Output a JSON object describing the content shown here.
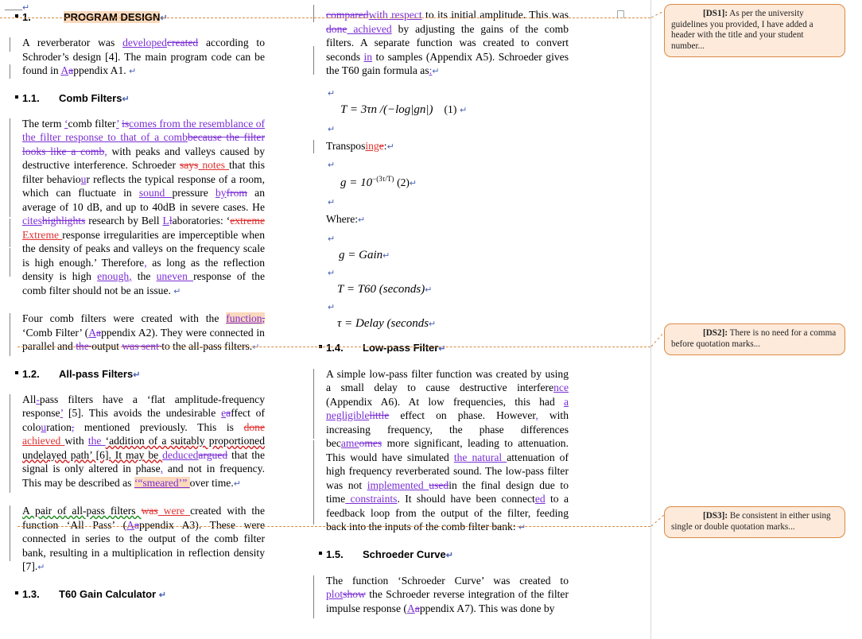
{
  "document": {
    "view": "word-track-changes-two-column",
    "colors": {
      "insert": "#7b2fd4",
      "insert_alt": "#e03030",
      "comment_fill": "#fdeadb",
      "comment_border": "#d98b45",
      "highlight": "#fbd9bd",
      "changebar": "#808080"
    }
  },
  "column_one": {
    "heading_1": {
      "number": "1.",
      "title": "PROGRAM DESIGN"
    },
    "para_1": {
      "t1": "A reverberator was ",
      "ins1": "developed",
      "del1": "created",
      "t2": " according to Schroder’s design [4]. The main program code can be found in ",
      "ins2": "A",
      "del2": "a",
      "t3": "ppendix A1. "
    },
    "heading_1_1": {
      "number": "1.1.",
      "title": "Comb Filters"
    },
    "para_2": {
      "t1": "The term ",
      "ins_q1": "‘",
      "t2": "comb filter",
      "ins_q2": "’",
      "t3": " ",
      "del1": "is",
      "ins1": "comes from the resemblance of the filter response to that of a comb",
      "del2": "because the filter looks like a comb",
      "ins_comma": ",",
      "t4": " with peaks and valleys caused by destructive interference. Schroeder ",
      "del3": "says",
      "ins2": " notes ",
      "t5": "that this filter behavio",
      "ins3": "u",
      "t6": "r reflects the typical response of a room, which can fluctuate in ",
      "ins4": "sound ",
      "t7": "pressure ",
      "ins5": "by",
      "del4": "from",
      "t8": " an average of 10 dB, and up to 40dB in severe cases. He ",
      "ins6": "cites",
      "del5": "highlights",
      "t9": " research by Bell ",
      "ins7": "L",
      "del6": "l",
      "t10": "aboratories: ‘",
      "del7": "extreme",
      "ins8": " Extreme ",
      "t11": "response irregularities are imperceptible when the density of peaks and valleys on the frequency scale is high enough.’ Therefore",
      "ins_c2": ",",
      "t12": " as long as the reflection density is high ",
      "ins9": "enough",
      "ins_c3": ",",
      "t13": " the ",
      "ins10": "uneven ",
      "t14": "response of the comb filter should not be an issue. "
    },
    "para_3": {
      "t1": "Four comb filters were created with the ",
      "hl_ins": "function",
      "hl_del": ",",
      "t2": " ‘Comb Filter’ (",
      "ins1": "A",
      "del1": "a",
      "t3": "ppendix A2). They were connected in parallel and ",
      "del2": "the ",
      "t4": "output ",
      "del3": "was sent ",
      "t5": "to the all-pass filters."
    },
    "heading_1_2": {
      "number": "1.2.",
      "title": "All-pass Filters"
    },
    "para_4": {
      "t1": "All",
      "ins_hyph": "-",
      "t2": "pass filters have a ‘flat amplitude-frequency response",
      "ins_q": "’",
      "t3": " [5]. This avoids the undesirable ",
      "ins1": "e",
      "del1": "a",
      "t4": "ffect of colo",
      "ins2": "u",
      "t5": "ration",
      "del2": ",",
      "t6": " mentioned previously. This is ",
      "del3": "done",
      "ins3": " achieved ",
      "t7": "with ",
      "ins4": "the ",
      "t8": "‘addition of a suitably proportioned undelayed path’ [6]. It may be ",
      "ins5": "deduced",
      "del4": "argued",
      "t9": " that the signal is only altered in phase",
      "ins_c": ",",
      "t10": " and not in frequency. This may be described as ",
      "hl": "‘“smeared’” ",
      "t11": "over time."
    },
    "para_5": {
      "t1": "A pair of all-pass filters ",
      "del1": "was",
      "ins1": " were ",
      "t2": "created with the function ‘All Pass’ (",
      "ins2": "A",
      "del2": "a",
      "t3": "ppendix A3). These were connected in series to the output of the comb filter bank, resulting in a multiplication in reflection density [7]."
    },
    "heading_1_3": {
      "number": "1.3.",
      "title": "T60 Gain Calculator "
    }
  },
  "column_two": {
    "para_1": {
      "del1": "compared",
      "ins1": "with respect",
      "t1": " to its initial amplitude. This was ",
      "del2": "done",
      "ins2": " achieved",
      "t2": " by adjusting the gains of the comb filters. A separate function was created to convert seconds ",
      "ins3": "in",
      "t3": " to samples (Appendix A5). Schroeder gives the T60 gain formula as",
      "ins4": ":"
    },
    "equation_1": {
      "body": "T = 3τn /(−log|gn|)",
      "number": "(1)"
    },
    "transposing": {
      "t1": "Transpos",
      "ins": "ing",
      "del": "e",
      "t2": ":"
    },
    "equation_2": {
      "base": "g = 10",
      "exponent": "−(3τ/T)",
      "number": "(2)"
    },
    "where_label": "Where:",
    "var_g": "g = Gain",
    "var_T": "T = T60 (seconds)",
    "var_tau": "τ  = Delay (seconds",
    "heading_1_4": {
      "number": "1.4.",
      "title": "Low-pass Filter"
    },
    "para_2": {
      "t1": "A simple low-pass filter function was created by using a small delay to cause destructive interfere",
      "ins1": "nce",
      "t2": " (Appendix A6). At low frequencies, this had ",
      "ins2": "a negligible",
      "del1": "little",
      "t3": " effect on phase. However",
      "ins_c": ",",
      "t4": " with increasing frequency, the phase differences bec",
      "ins3": "ame",
      "del2": "omes",
      "t5": " more significant, leading to attenuation. This would have simulated ",
      "ins4": "the natural ",
      "t6": "attenuation of high frequency reverberated sound. The low-pass filter was not ",
      "ins5": "implemented ",
      "del3": "used",
      "t7": "in the final design due to time",
      "ins6": " constraints",
      "t8": ". It should have been connect",
      "ins7": "ed",
      "t9": " to a feedback loop from the output of the filter, feeding back into the inputs of the comb filter bank",
      "t10": ": "
    },
    "heading_1_5": {
      "number": "1.5.",
      "title": "Schroeder Curve"
    },
    "para_3": {
      "t1": "The function ‘Schroeder Curve’ was created to ",
      "ins1": "plot",
      "del1": "show",
      "t2": " the Schroeder reverse integration of the filter impulse response (",
      "ins2": "A",
      "del2": "a",
      "t3": "ppendix A7). This was done by"
    }
  },
  "comments": [
    {
      "tag": "[DS1]:",
      "text": " As per the university guidelines you provided, I have added a header with the title and your student number..."
    },
    {
      "tag": "[DS2]:",
      "text": " There is no need for a comma before quotation marks..."
    },
    {
      "tag": "[DS3]:",
      "text": " Be consistent in either using single or double quotation marks..."
    }
  ]
}
